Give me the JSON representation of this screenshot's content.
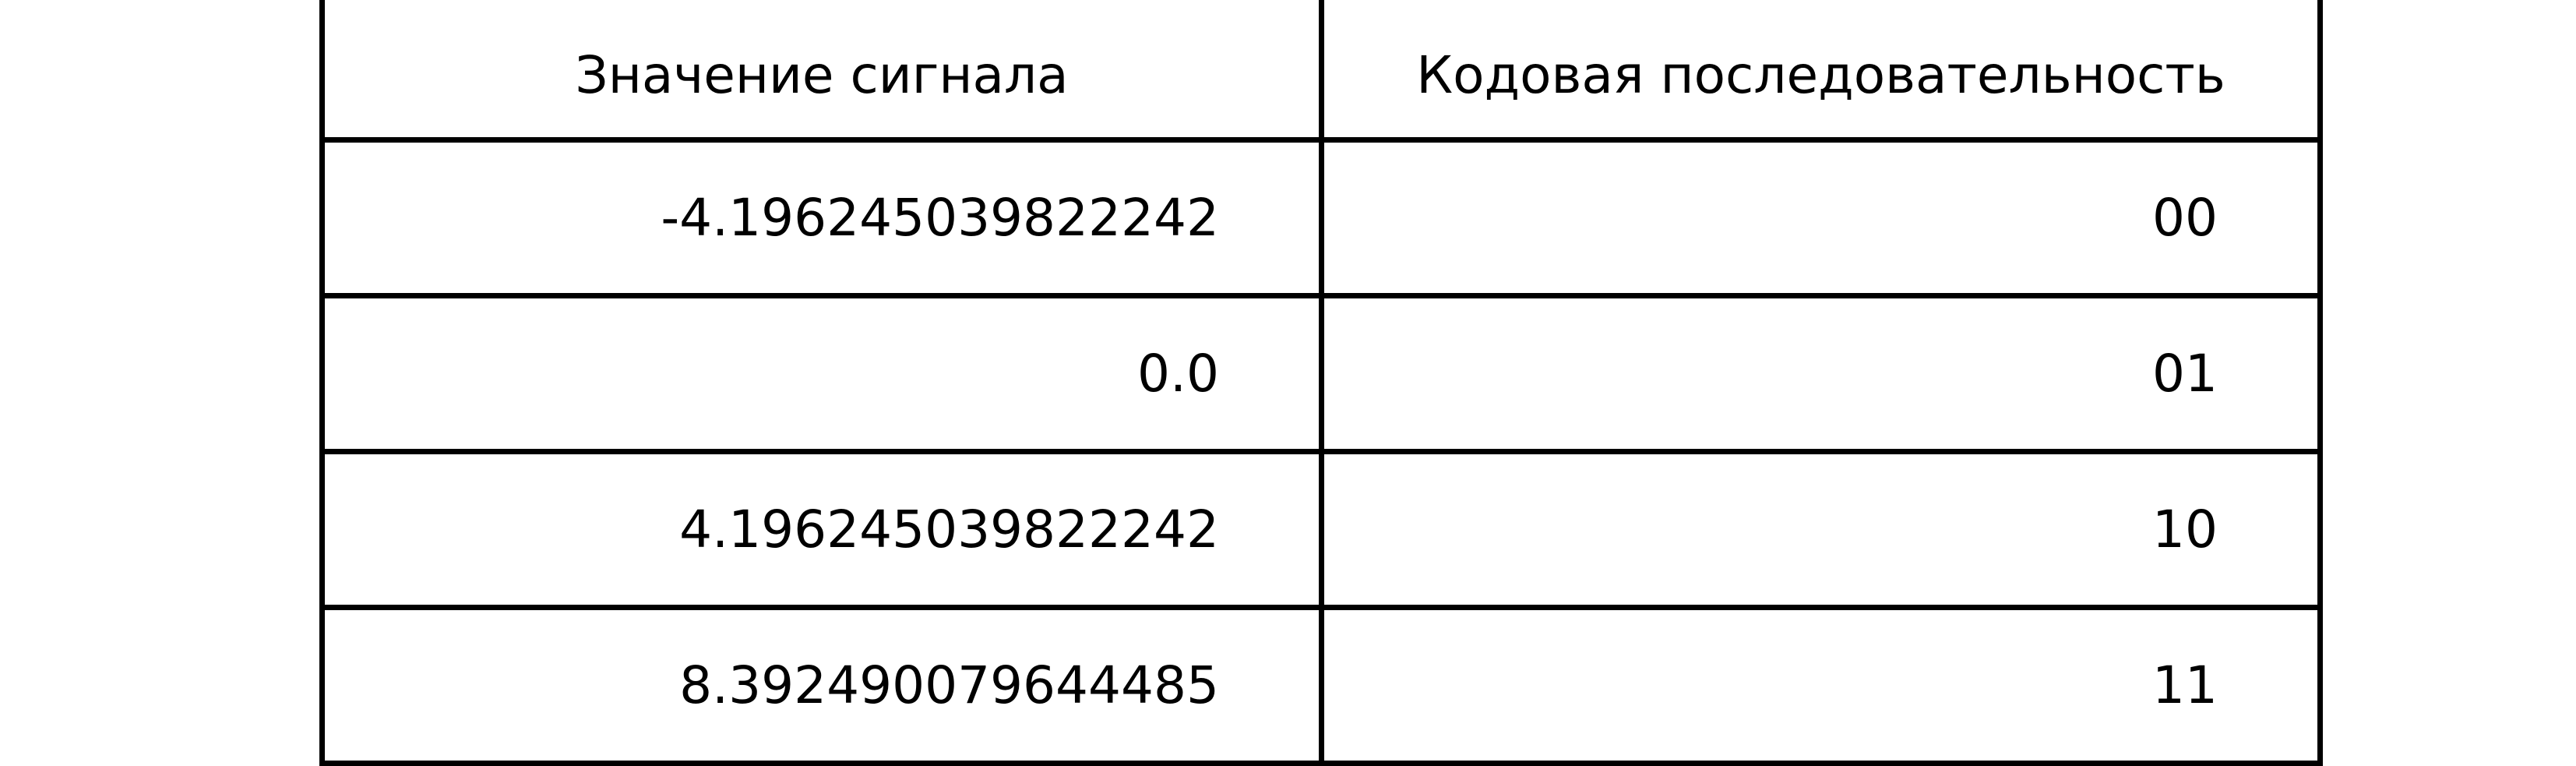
{
  "table": {
    "headers": [
      "Значение сигнала",
      "Кодовая последовательность"
    ],
    "rows": [
      [
        "-4.196245039822242",
        "00"
      ],
      [
        "0.0",
        "01"
      ],
      [
        "4.196245039822242",
        "10"
      ],
      [
        "8.392490079644485",
        "11"
      ]
    ]
  }
}
